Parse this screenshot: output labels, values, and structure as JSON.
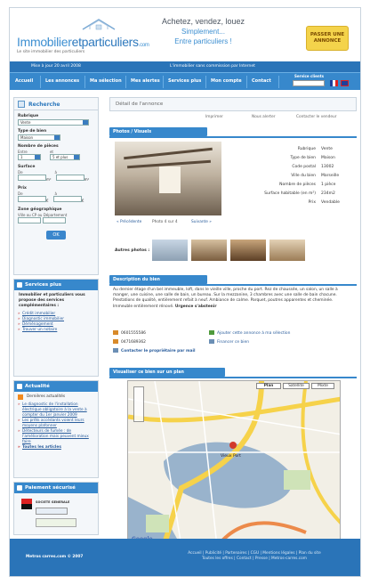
{
  "header": {
    "logo_name_a": "Immobilier",
    "logo_name_b": "etparticuliers",
    "logo_suffix": ".com",
    "logo_tagline": "Le site immobilier des particuliers",
    "slogan_1": "Achetez, vendez, louez",
    "slogan_2": "Simplement...",
    "slogan_3": "Entre particuliers !",
    "cta_line1": "PASSER UNE",
    "cta_line2": "ANNONCE"
  },
  "subbar": {
    "date": "Mise à jour 20 avril 2008",
    "notice": "L'immobilier sans commission par Internet"
  },
  "nav": {
    "items": [
      "Accueil",
      "Les annonces",
      "Ma sélection",
      "Mes alertes",
      "Services plus",
      "Mon compte",
      "Contact"
    ],
    "services_label": "Service clients"
  },
  "sidebar": {
    "search_title": "Recherche",
    "rubrique_label": "Rubrique",
    "rubrique_value": "Vente",
    "type_label": "Type de bien",
    "type_value": "Maison",
    "pieces_label": "Nombre de pièces",
    "entre": "Entre",
    "et": "et",
    "pieces_min": "1",
    "pieces_max": "5 et plus",
    "surface_label": "Surface",
    "de": "De",
    "a": "à",
    "m2": "m²",
    "prix_label": "Prix",
    "euro": "€",
    "zone_label": "Zone géographique",
    "zone_hint": "Ville ou CP ou Département",
    "ok": "OK",
    "services_title": "Services plus",
    "services_intro": "Immobilier et particuliers vous propose des services complémentaires :",
    "services_links": [
      "Crédit immobilier",
      "Diagnostic immobilier",
      "Déménagement",
      "Trouver un notaire"
    ],
    "actu_title": "Actualité",
    "actu_rss": "Dernières actualités",
    "actu_links": [
      "Le diagnostic de l'installation électrique obligatoire à la vente à compter du 1er janvier 2009",
      "Les prêts accédants voient leurs moyens plafonner",
      "Détecteurs de fumée : de l'amélioration mais peuvent mieux faire",
      "Toutes les articles"
    ],
    "paiement_title": "Paiement sécurisé",
    "bank": "SOCIETE GENERALE"
  },
  "main": {
    "breadcrumb": "Détail de l'annonce",
    "tools": [
      "Imprimer",
      "Nous alerter",
      "Contacter le vendeur"
    ],
    "photos_title": "Photos / Visuels",
    "photo_nav": [
      "« Précédente",
      "Photo 4 sur 4",
      "Suivante »"
    ],
    "other_photos": "Autres photos :",
    "specs": [
      {
        "k": "Rubrique",
        "v": "Vente"
      },
      {
        "k": "Type de bien",
        "v": "Maison"
      },
      {
        "k": "Code postal",
        "v": "13002"
      },
      {
        "k": "Ville du bien",
        "v": "Marseille"
      },
      {
        "k": "Nombre de pièces",
        "v": "1 pièce"
      },
      {
        "k": "Surface habitable (en m²)",
        "v": "234m2"
      },
      {
        "k": "Prix",
        "v": "Vendable"
      }
    ],
    "desc_title": "Description du bien",
    "desc_text": "Au dernier étage d'un bel immeuble, loft, dans le vieille ville, proche du port. Rez de chaussée, un salon, un salle à manger, une cuisine, une salle de bain, un bureau. Sur la mezzanine, 3 chambres avec une salle de bain chacune. Prestations de qualité, entièrement refait à neuf. Ambiance de calme. Parquet, poutres apparentes et cheminée. Immeuble entièrement rénové.",
    "desc_bold": "Urgence s'abstenir",
    "phones": [
      "0601555586",
      "0471689362"
    ],
    "add_selection": "Ajouter cette annonce à ma sélection",
    "finance": "Financer ce bien",
    "contact_owner": "Contacter le propriétaire par mail",
    "map_title": "Visualiser ce bien sur un plan",
    "map_buttons": [
      "Plan",
      "Satellite",
      "Mixte"
    ],
    "map_place": "Vieux Port",
    "map_google": "Google"
  },
  "footer": {
    "copy": "Metros carres.com © 2007",
    "links_1": "Accueil | Publicité | Partenaires | CGU | Mentions légales | Plan du site",
    "links_2": "Toutes les offres | Contact | Presse | Metros-carres.com"
  },
  "colors": {
    "brand": "#3788cc",
    "dark": "#2a74b8",
    "accent": "#f4d34b",
    "link": "#2a5d9c"
  }
}
